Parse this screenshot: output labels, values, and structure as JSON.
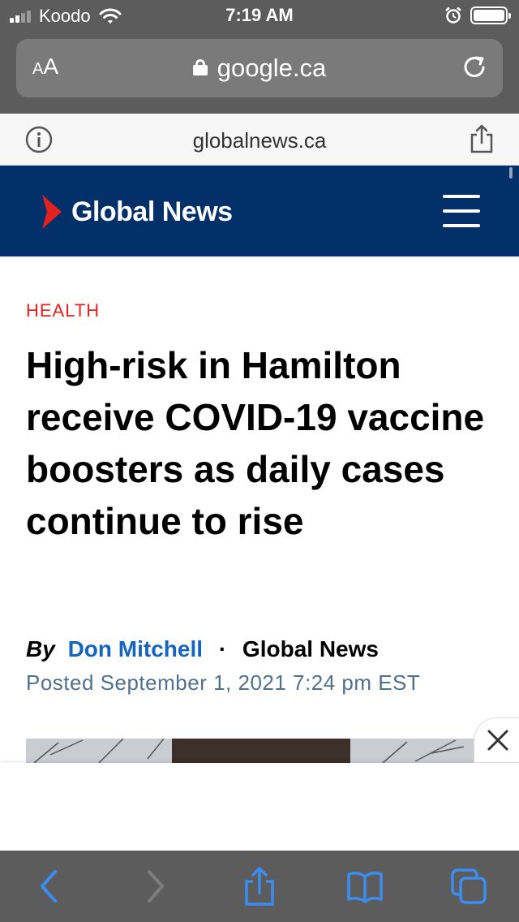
{
  "status_bar": {
    "carrier": "Koodo",
    "time": "7:19 AM",
    "signal_bars_active": 2,
    "signal_bars_total": 4
  },
  "browser": {
    "text_size_label_small": "A",
    "text_size_label_large": "A",
    "url": "google.ca",
    "site_domain": "globalnews.ca"
  },
  "site_header": {
    "logo_text": "Global News",
    "brand_color": "#033069",
    "accent_color": "#e2221e"
  },
  "article": {
    "category": "HEALTH",
    "headline": "High-risk in Hamilton receive COVID-19 vaccine boosters as daily cases continue to rise",
    "byline_prefix": "By",
    "author": "Don Mitchell",
    "separator": "·",
    "outlet": "Global News",
    "posted": "Posted September 1, 2021 7:24 pm EST"
  },
  "icons": {
    "alarm": "alarm-icon",
    "wifi": "wifi-icon",
    "lock": "lock-icon",
    "reload": "reload-icon",
    "info": "info-icon",
    "share": "share-icon",
    "menu": "hamburger-menu-icon",
    "close": "close-icon",
    "back": "back-icon",
    "forward": "forward-icon",
    "bookmarks": "bookmarks-icon",
    "tabs": "tabs-icon"
  }
}
